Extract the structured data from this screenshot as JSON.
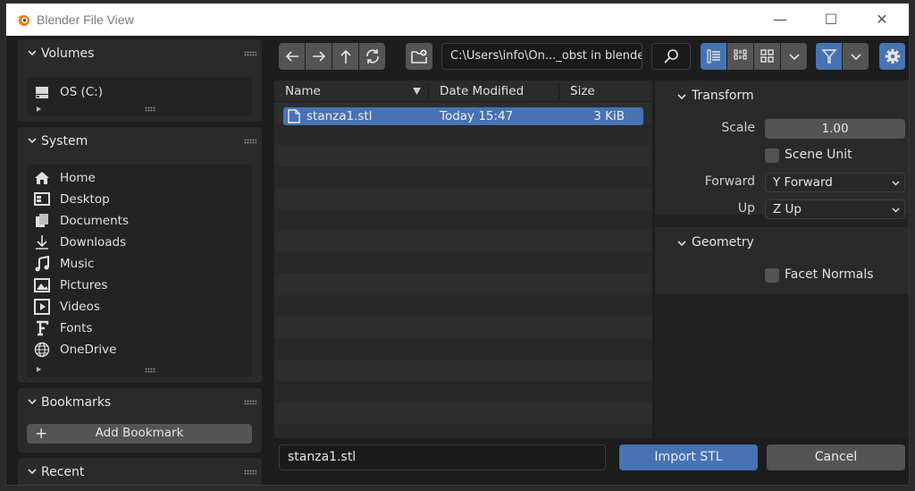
{
  "window": {
    "title": "Blender File View",
    "minimize_glyph": "—",
    "maximize_glyph": "☐",
    "close_glyph": "✕"
  },
  "sidebar": {
    "volumes": {
      "title": "Volumes",
      "items": [
        {
          "label": "OS (C:)",
          "icon": "drive-icon"
        }
      ]
    },
    "system": {
      "title": "System",
      "items": [
        {
          "label": "Home",
          "icon": "home-icon"
        },
        {
          "label": "Desktop",
          "icon": "desktop-icon"
        },
        {
          "label": "Documents",
          "icon": "documents-icon"
        },
        {
          "label": "Downloads",
          "icon": "download-icon"
        },
        {
          "label": "Music",
          "icon": "music-icon"
        },
        {
          "label": "Pictures",
          "icon": "pictures-icon"
        },
        {
          "label": "Videos",
          "icon": "videos-icon"
        },
        {
          "label": "Fonts",
          "icon": "fonts-icon"
        },
        {
          "label": "OneDrive",
          "icon": "globe-icon"
        }
      ]
    },
    "bookmarks": {
      "title": "Bookmarks",
      "add_label": "Add Bookmark",
      "add_glyph": "+"
    },
    "recent": {
      "title": "Recent"
    }
  },
  "toolbar": {
    "path": "C:\\Users\\info\\On..._obst in blender\\"
  },
  "file_list": {
    "columns": {
      "name": "Name",
      "date": "Date Modified",
      "size": "Size"
    },
    "rows": [
      {
        "name": "stanza1.stl",
        "date": "Today 15:47",
        "size": "3 KiB",
        "selected": true
      }
    ]
  },
  "properties": {
    "transform": {
      "title": "Transform",
      "scale_label": "Scale",
      "scale_value": "1.00",
      "scene_unit_label": "Scene Unit",
      "scene_unit_checked": false,
      "forward_label": "Forward",
      "forward_value": "Y Forward",
      "up_label": "Up",
      "up_value": "Z Up"
    },
    "geometry": {
      "title": "Geometry",
      "facet_normals_label": "Facet Normals",
      "facet_normals_checked": false
    }
  },
  "footer": {
    "filename": "stanza1.stl",
    "import_label": "Import STL",
    "cancel_label": "Cancel"
  },
  "colors": {
    "accent": "#4772b3",
    "panel": "#2a2a2a",
    "background": "#1d1d1d"
  }
}
